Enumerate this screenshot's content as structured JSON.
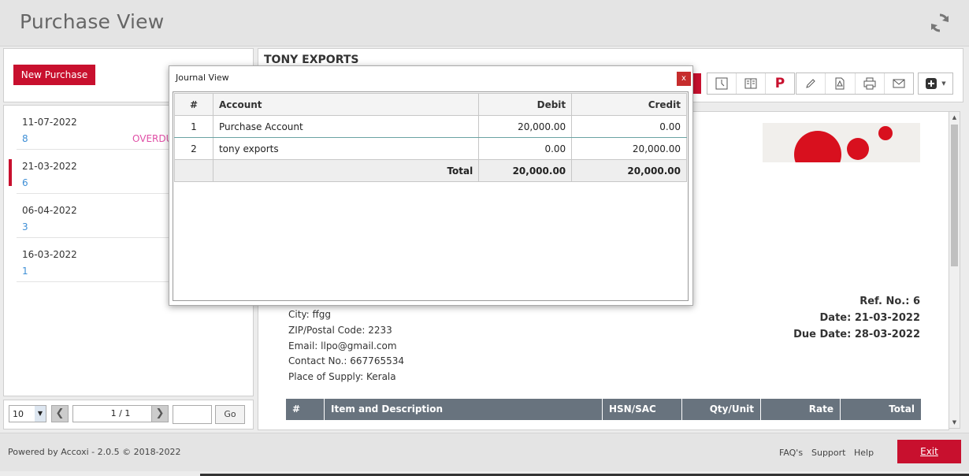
{
  "page": {
    "title": "Purchase View"
  },
  "left": {
    "new_button": "New Purchase",
    "items": [
      {
        "date": "11-07-2022",
        "number": "8",
        "status": "OVERDU"
      },
      {
        "date": "21-03-2022",
        "number": "6",
        "status": ""
      },
      {
        "date": "06-04-2022",
        "number": "3",
        "status": ""
      },
      {
        "date": "16-03-2022",
        "number": "1",
        "status": ""
      }
    ],
    "pager": {
      "page_size": "10",
      "page_info": "1 / 1",
      "go_label": "Go"
    }
  },
  "document": {
    "company": "TONY EXPORTS",
    "address_lines": [
      "City: ffgg",
      "ZIP/Postal Code: 2233",
      "Email: llpo@gmail.com",
      "Contact No.: 667765534",
      "Place of Supply: Kerala"
    ],
    "ref_no": "Ref. No.: 6",
    "date": "Date: 21-03-2022",
    "due_date": "Due Date: 28-03-2022",
    "table_headers": [
      "#",
      "Item and Description",
      "HSN/SAC",
      "Qty/Unit",
      "Rate",
      "Total"
    ]
  },
  "journal": {
    "title": "Journal View",
    "close": "x",
    "headers": {
      "num": "#",
      "account": "Account",
      "debit": "Debit",
      "credit": "Credit"
    },
    "rows": [
      {
        "num": "1",
        "account": "Purchase Account",
        "debit": "20,000.00",
        "credit": "0.00"
      },
      {
        "num": "2",
        "account": "tony exports",
        "debit": "0.00",
        "credit": "20,000.00"
      }
    ],
    "total": {
      "label": "Total",
      "debit": "20,000.00",
      "credit": "20,000.00"
    }
  },
  "footer": {
    "powered": "Powered by Accoxi - 2.0.5 © 2018-2022",
    "faqs": "FAQ's",
    "support": "Support",
    "help": "Help",
    "exit": "Exit"
  },
  "colors": {
    "accent": "#c8102e",
    "link": "#3f8fd6",
    "overdue": "#e04fa6",
    "table_head": "#68737e"
  },
  "icons": [
    "refresh-icon",
    "clock-icon",
    "ledger-icon",
    "pay-icon",
    "edit-icon",
    "pdf-icon",
    "print-icon",
    "mail-icon",
    "add-icon",
    "chevron-down-icon",
    "chevron-left-icon",
    "chevron-right-icon",
    "close-icon"
  ]
}
